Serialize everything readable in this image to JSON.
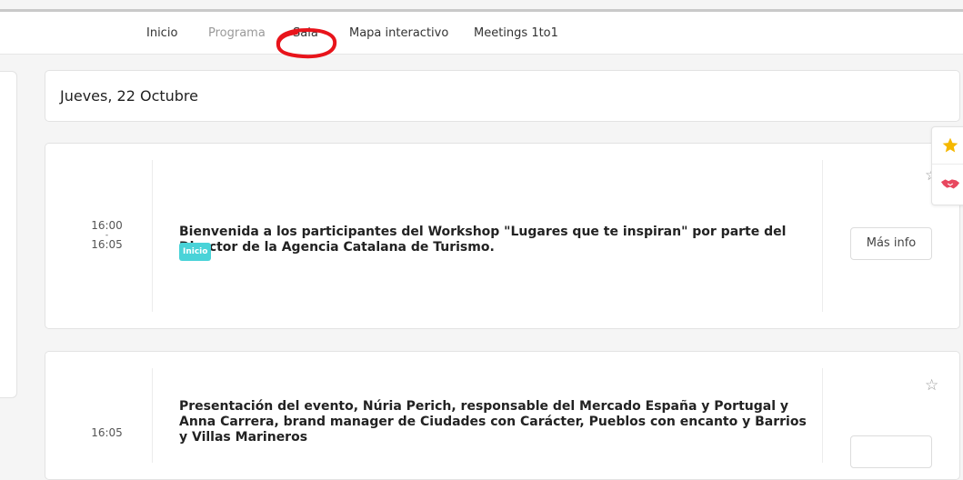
{
  "nav": {
    "items": [
      {
        "label": "Inicio"
      },
      {
        "label": "Programa"
      },
      {
        "label": "Sala"
      },
      {
        "label": "Mapa interactivo"
      },
      {
        "label": "Meetings 1to1"
      }
    ]
  },
  "day": {
    "label": "Jueves, 22 Octubre"
  },
  "sessions": [
    {
      "start": "16:00",
      "separator": "-",
      "end": "16:05",
      "title": "Bienvenida a los participantes del Workshop \"Lugares que te inspiran\" por parte del Director de la Agencia Catalana de Turismo.",
      "tag": "Inicio",
      "button": "Más info"
    },
    {
      "start": "16:05",
      "title": "Presentación del evento, Núria Perich, responsable del Mercado España y Portugal y Anna Carrera, brand manager de Ciudades con Carácter, Pueblos con encanto y Barrios y Villas Marineros"
    }
  ],
  "colors": {
    "annotation": "#e8141b",
    "tag": "#49d3d8",
    "star_active": "#f5b800",
    "handshake": "#e8475f"
  }
}
